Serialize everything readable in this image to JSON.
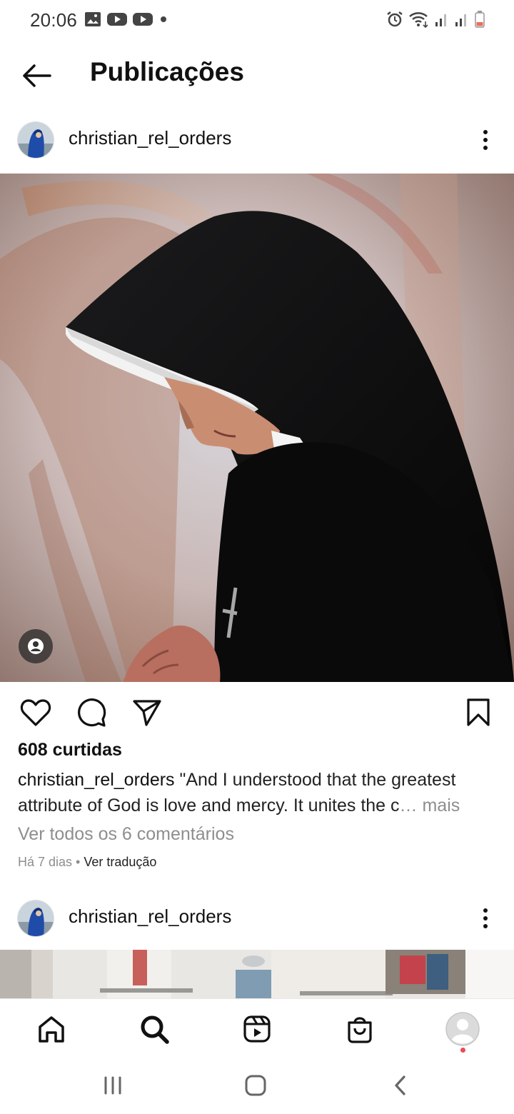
{
  "status_bar": {
    "time": "20:06",
    "left_icons": [
      "image-icon",
      "youtube-icon",
      "youtube-icon",
      "dot-icon"
    ],
    "right_icons": [
      "alarm-icon",
      "wifi-icon",
      "signal-icon",
      "signal-icon",
      "battery-icon"
    ],
    "battery_color": "#e8705a"
  },
  "header": {
    "title": "Publicações",
    "back_icon": "arrow-left-icon"
  },
  "posts": [
    {
      "username": "christian_rel_orders",
      "likes": "608 curtidas",
      "caption_user": "christian_rel_orders",
      "caption_text": " \"And I understood that the greatest attribute of God is love and mercy. It unites the c",
      "caption_more": "… mais",
      "view_comments": "Ver todos os 6 comentários",
      "time_ago": "Há 7 dias",
      "separator": " • ",
      "translate": "Ver tradução"
    },
    {
      "username": "christian_rel_orders"
    }
  ],
  "bottom_nav": [
    "home-icon",
    "search-icon",
    "reels-icon",
    "shop-icon",
    "profile-icon"
  ],
  "system_nav": [
    "recents-icon",
    "home-square-icon",
    "back-chevron-icon"
  ],
  "colors": {
    "notification_dot": "#ed4956",
    "secondary_text": "#8e8e8e"
  }
}
